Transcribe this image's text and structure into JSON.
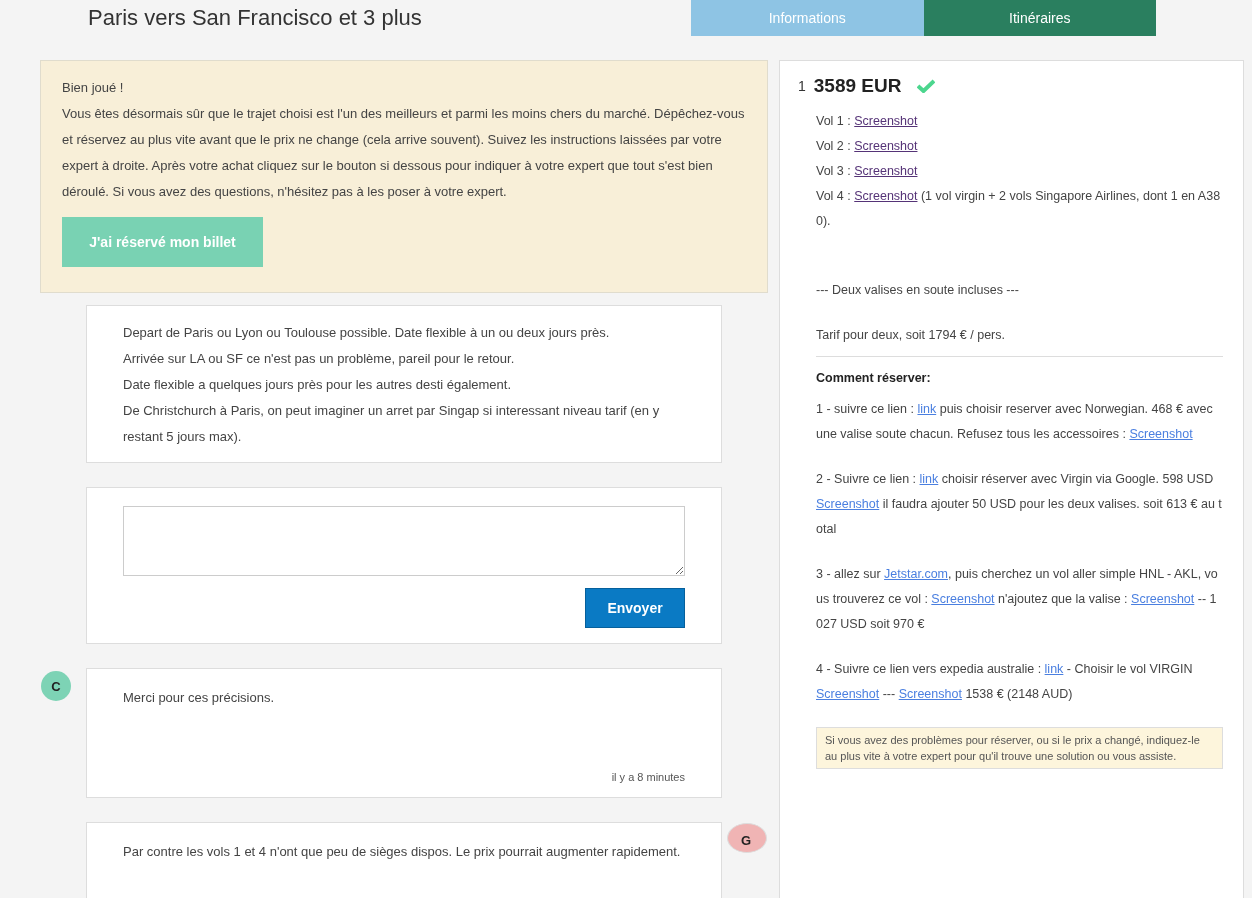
{
  "title": "Paris vers San Francisco et 3 plus",
  "tabs": [
    {
      "label": "Informations",
      "selected": false
    },
    {
      "label": "Itinéraires",
      "selected": true
    }
  ],
  "notice": {
    "heading": "Bien joué !",
    "text": "Vous êtes désormais sûr que le trajet choisi est l'un des meilleurs et parmi les moins chers du marché. Dépêchez-vous et réservez au plus vite avant que le prix ne change (cela arrive souvent). Suivez les instructions laissées par votre expert à droite. Après votre achat cliquez sur le bouton si dessous pour indiquer à votre expert que tout s'est bien déroulé. Si vous avez des questions, n'hésitez pas à les poser à votre expert.",
    "button": "J'ai réservé mon billet"
  },
  "request": [
    "Depart de Paris ou Lyon ou Toulouse possible. Date flexible à un ou deux jours près.",
    "Arrivée sur LA ou SF ce n'est pas un problème, pareil pour le retour.",
    "Date flexible a quelques jours près pour les autres desti également.",
    "De Christchurch à Paris, on peut imaginer un arret par Singap si interessant niveau tarif (en y restant 5 jours max)."
  ],
  "composer": {
    "button": "Envoyer"
  },
  "messages": [
    {
      "kind": "customer",
      "avatar": "C",
      "color": "#7dd3b5",
      "text": "Merci pour ces précisions.",
      "time": "il y a 8 minutes"
    },
    {
      "kind": "expert",
      "avatar": "G",
      "color": "#f0b4b4",
      "text": "Par contre les vols 1 et 4 n'ont que peu de sièges dispos. Le prix pourrait augmenter rapidement."
    }
  ],
  "itinerary": {
    "index": "1",
    "price": "3589 EUR",
    "confirmed": true,
    "flights": [
      [
        {
          "text": "Vol 1 : "
        },
        {
          "text": "Screenshot",
          "kind": "link",
          "visited": true
        }
      ],
      [
        {
          "text": "Vol 2 : "
        },
        {
          "text": "Screenshot",
          "kind": "link",
          "visited": true
        }
      ],
      [
        {
          "text": "Vol 3 : "
        },
        {
          "text": "Screenshot",
          "kind": "link",
          "visited": true
        }
      ],
      [
        {
          "text": "Vol 4 : "
        },
        {
          "text": "Screenshot",
          "kind": "link",
          "visited": true
        },
        {
          "text": " (1 vol virgin + 2 vols Singapore Airlines, dont 1 en A380)."
        }
      ]
    ],
    "baggage": "--- Deux valises en soute incluses ---",
    "tariff": "Tarif pour deux, soit 1794 € / pers.",
    "how_title": "Comment réserver:",
    "steps": [
      [
        {
          "text": "1 - suivre ce lien : "
        },
        {
          "text": "link",
          "kind": "link",
          "visited": false
        },
        {
          "text": " puis choisir reserver avec Norwegian. 468 € avec  une valise soute chacun. Refusez tous les accessoires : "
        },
        {
          "text": "Screenshot",
          "kind": "link",
          "visited": false
        }
      ],
      [
        {
          "text": "2 - Suivre ce lien : "
        },
        {
          "text": "link",
          "kind": "link",
          "visited": false
        },
        {
          "text": " choisir réserver avec Virgin via Google. 598 USD "
        },
        {
          "text": "Screenshot",
          "kind": "link",
          "visited": false
        },
        {
          "text": " il faudra ajouter 50 USD pour les deux valises. soit 613 € au total"
        }
      ],
      [
        {
          "text": "3 - allez sur "
        },
        {
          "text": "Jetstar.com",
          "kind": "link",
          "visited": false
        },
        {
          "text": ", puis cherchez un vol aller simple HNL - AKL, vous trouverez ce vol : "
        },
        {
          "text": "Screenshot",
          "kind": "link",
          "visited": false
        },
        {
          "text": " n'ajoutez que la valise : "
        },
        {
          "text": "Screenshot",
          "kind": "link",
          "visited": false
        },
        {
          "text": " -- 1027 USD soit 970 €"
        }
      ],
      [
        {
          "text": "4 - Suivre ce lien vers expedia australie : "
        },
        {
          "text": "link",
          "kind": "link",
          "visited": false
        },
        {
          "text": " - Choisir le vol VIRGIN "
        },
        {
          "text": "Screenshot",
          "kind": "link",
          "visited": false
        },
        {
          "text": " --- "
        },
        {
          "text": "Screenshot",
          "kind": "link",
          "visited": false
        },
        {
          "text": " 1538 € (2148 AUD)"
        }
      ]
    ],
    "warning": "Si vous avez des problèmes pour réserver, ou si le prix a changé, indiquez-le au plus vite à votre expert pour qu'il trouve une solution ou vous assiste."
  }
}
